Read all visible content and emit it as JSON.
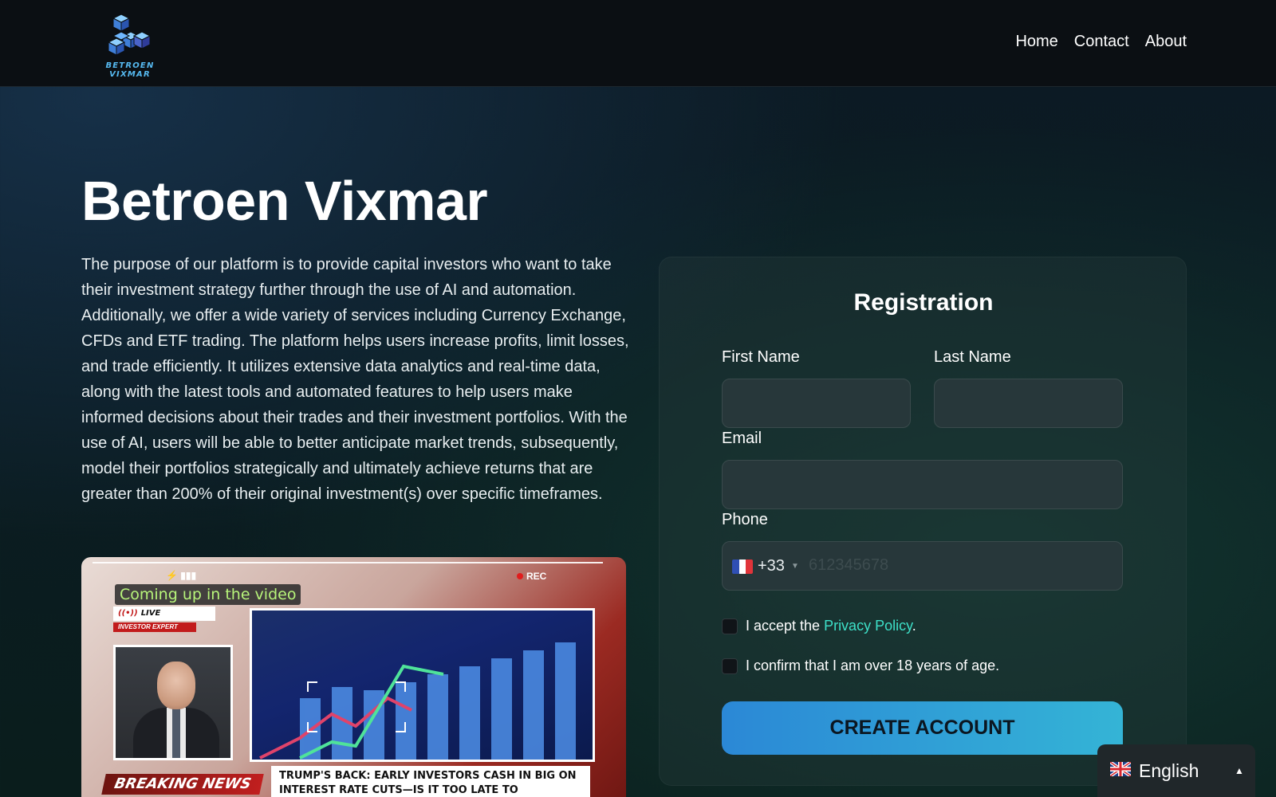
{
  "brand": {
    "name_logo": "BETROEN VIXMAR",
    "logo_icon": "stacked-cubes-logo",
    "accent": "#56b9f0"
  },
  "nav": {
    "items": [
      "Home",
      "Contact",
      "About"
    ]
  },
  "hero": {
    "title": "Betroen Vixmar",
    "description": "The purpose of our platform is to provide capital investors who want to take their investment strategy further through the use of AI and automation. Additionally, we offer a wide variety of services including Currency Exchange, CFDs and ETF trading. The platform helps users increase profits, limit losses, and trade efficiently. It utilizes extensive data analytics and real-time data, along with the latest tools and automated features to help users make informed decisions about their trades and their investment portfolios. With the use of AI, users will be able to better anticipate market trends, subsequently, model their portfolios strategically and ultimately achieve returns that are greater than 200% of their original investment(s) over specific timeframes."
  },
  "video": {
    "coming_up": "Coming up in the video",
    "rec_label": "REC",
    "live_label": "LIVE",
    "expert_label": "INVESTOR EXPERT",
    "breaking_label": "BREAKING NEWS",
    "headline": "TRUMP'S BACK: EARLY INVESTORS CASH IN BIG ON INTEREST RATE CUTS—IS IT TOO LATE TO"
  },
  "registration": {
    "title": "Registration",
    "first_name_label": "First Name",
    "last_name_label": "Last Name",
    "email_label": "Email",
    "phone_label": "Phone",
    "first_name_value": "",
    "last_name_value": "",
    "email_value": "",
    "phone_country": "France",
    "phone_code": "+33",
    "phone_placeholder": "612345678",
    "privacy_prefix": "I accept the ",
    "privacy_link": "Privacy Policy",
    "privacy_suffix": ".",
    "age_confirm": "I confirm that I am over 18 years of age.",
    "privacy_checked": false,
    "age_checked": false,
    "submit_label": "CREATE ACCOUNT",
    "button_colors": [
      "#2b88d6",
      "#34b4d6"
    ]
  },
  "language": {
    "selected": "English",
    "flag": "uk-flag-icon"
  }
}
